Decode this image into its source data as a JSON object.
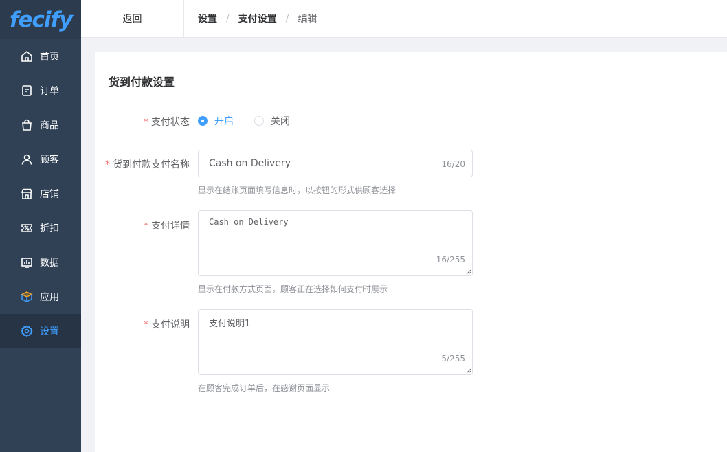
{
  "brand": {
    "logo_text": "fecify"
  },
  "sidebar": {
    "items": [
      {
        "label": "首页",
        "icon": "home-icon",
        "active": false
      },
      {
        "label": "订单",
        "icon": "order-icon",
        "active": false
      },
      {
        "label": "商品",
        "icon": "shopping-bag-icon",
        "active": false
      },
      {
        "label": "顾客",
        "icon": "user-icon",
        "active": false
      },
      {
        "label": "店铺",
        "icon": "store-icon",
        "active": false
      },
      {
        "label": "折扣",
        "icon": "discount-ticket-icon",
        "active": false
      },
      {
        "label": "数据",
        "icon": "analytics-icon",
        "active": false
      },
      {
        "label": "应用",
        "icon": "app-cube-icon",
        "active": false
      },
      {
        "label": "设置",
        "icon": "gear-icon",
        "active": true
      }
    ]
  },
  "header": {
    "back_label": "返回",
    "breadcrumb": [
      "设置",
      "支付设置",
      "编辑"
    ],
    "separator": "/"
  },
  "page": {
    "title": "货到付款设置",
    "required_mark": "*",
    "status": {
      "label": "支付状态",
      "options": [
        "开启",
        "关闭"
      ],
      "selected": "开启"
    },
    "name": {
      "label": "货到付款支付名称",
      "value": "Cash on Delivery",
      "counter": "16/20",
      "hint": "显示在结账页面填写信息时，以按钮的形式供顾客选择"
    },
    "details": {
      "label": "支付详情",
      "value": "Cash on Delivery",
      "counter": "16/255",
      "hint": "显示在付款方式页面，顾客正在选择如何支付时展示"
    },
    "description": {
      "label": "支付说明",
      "value": "支付说明1",
      "counter": "5/255",
      "hint": "在顾客完成订单后，在感谢页面显示"
    }
  },
  "colors": {
    "sidebar_bg": "#304156",
    "sidebar_active_bg": "#263445",
    "accent": "#409eff",
    "required": "#f56c6c",
    "logo_swoosh": "#f5a623"
  }
}
